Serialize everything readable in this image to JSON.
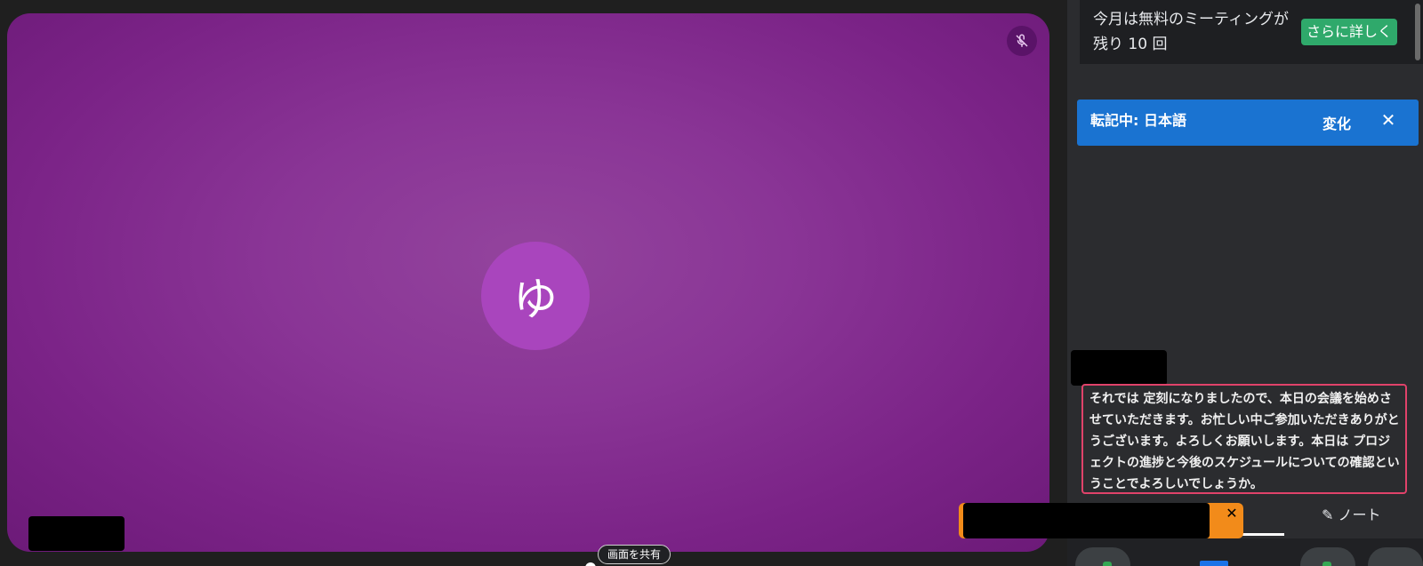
{
  "video": {
    "avatar_initial": "ゆ",
    "tile_color": "#8a3596",
    "avatar_color": "#a945bd",
    "mic_status_icon": "mic-off-icon"
  },
  "share_pill": {
    "label": "画面を共有"
  },
  "promo": {
    "text": "今月は無料のミーティングが残り 10 回",
    "button_label": "さらに詳しく",
    "button_color": "#2fa96b"
  },
  "transcription": {
    "label": "転記中: 日本語",
    "change_label": "変化",
    "close_icon": "close-icon",
    "bar_color": "#1a73d1"
  },
  "caption": {
    "text": "それでは 定刻になりましたので、本日の会議を始めさせていただきます。お忙しい中ご参加いただきありがとうございます。よろしくお願いします。本日は プロジェクトの進捗と今後のスケジュールについての確認ということでよろしいでしょうか。",
    "border_color": "#e0426a"
  },
  "tabs": {
    "notes_icon": "pencil-icon",
    "notes_label": "ノート"
  },
  "toast": {
    "close_icon": "close-icon",
    "color": "#f28b1a"
  }
}
